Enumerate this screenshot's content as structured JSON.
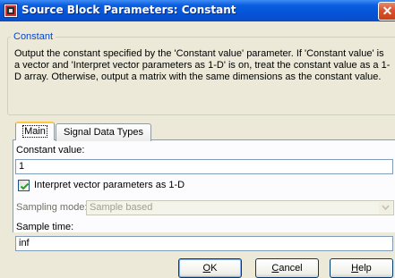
{
  "window": {
    "title": "Source Block Parameters: Constant",
    "icon": "simulink-block-icon",
    "close_icon": "close-icon",
    "colors": {
      "titlebar": "#0554d8",
      "close": "#d8542c",
      "group_label": "#0046d5",
      "tab_highlight": "#ffc83c"
    }
  },
  "group": {
    "label": "Constant",
    "description": "Output the constant specified by the 'Constant value' parameter. If 'Constant value' is a vector and 'Interpret vector parameters as 1-D' is on, treat the constant value as a 1-D array. Otherwise, output a matrix with the same dimensions as the constant value."
  },
  "tabs": [
    {
      "label": "Main",
      "active": true
    },
    {
      "label": "Signal Data Types",
      "active": false
    }
  ],
  "main": {
    "constant_value_label": "Constant value:",
    "constant_value": "1",
    "interpret_checkbox_label": "Interpret vector parameters as 1-D",
    "interpret_checked": true,
    "sampling_mode_label": "Sampling mode:",
    "sampling_mode_value": "Sample based",
    "sampling_mode_enabled": false,
    "sample_time_label": "Sample time:",
    "sample_time_value": "inf"
  },
  "buttons": {
    "ok_mnemonic": "O",
    "ok_rest": "K",
    "cancel_mnemonic": "C",
    "cancel_rest": "ancel",
    "help_mnemonic": "H",
    "help_rest": "elp"
  }
}
